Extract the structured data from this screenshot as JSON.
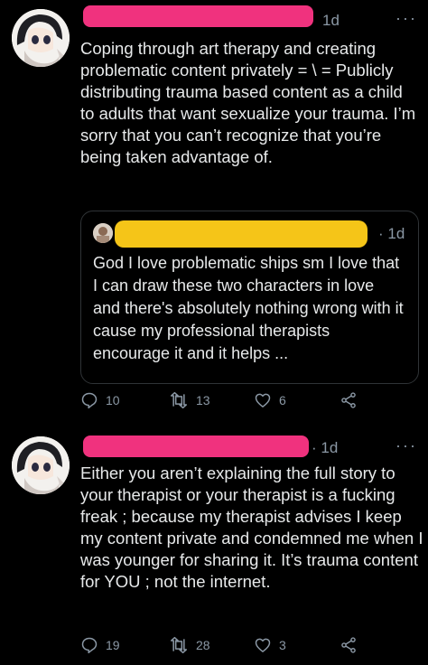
{
  "tweets": [
    {
      "timestamp": "1d",
      "text": "Coping through art therapy and creating problematic content privately = \\ = Publicly distributing trauma based content as a child to adults that want sexualize your trauma. I’m sorry that you can’t recognize that you’re being taken advantage of.",
      "quote": {
        "timestamp": "· 1d",
        "text": "God I love problematic ships sm I love that I can draw these two characters in love and there's absolutely nothing wrong with it cause my professional therapists encourage it and it helps ..."
      },
      "stats": {
        "replies": "10",
        "retweets": "13",
        "likes": "6"
      }
    },
    {
      "timestamp": "· 1d",
      "text": "Either you aren’t explaining the full story to your therapist or your therapist is a fucking freak ; because my therapist advises I keep my content private and condemned me when I was younger for sharing it. It’s trauma content for YOU ; not the internet.",
      "stats": {
        "replies": "19",
        "retweets": "28",
        "likes": "3"
      }
    }
  ],
  "colors": {
    "background": "#000000",
    "text": "#e7e9ea",
    "muted": "#8b98a5",
    "redaction_pink": "#f0327e",
    "redaction_yellow": "#f5c518"
  },
  "icons": [
    "reply-icon",
    "retweet-icon",
    "like-icon",
    "share-icon",
    "more-icon"
  ]
}
